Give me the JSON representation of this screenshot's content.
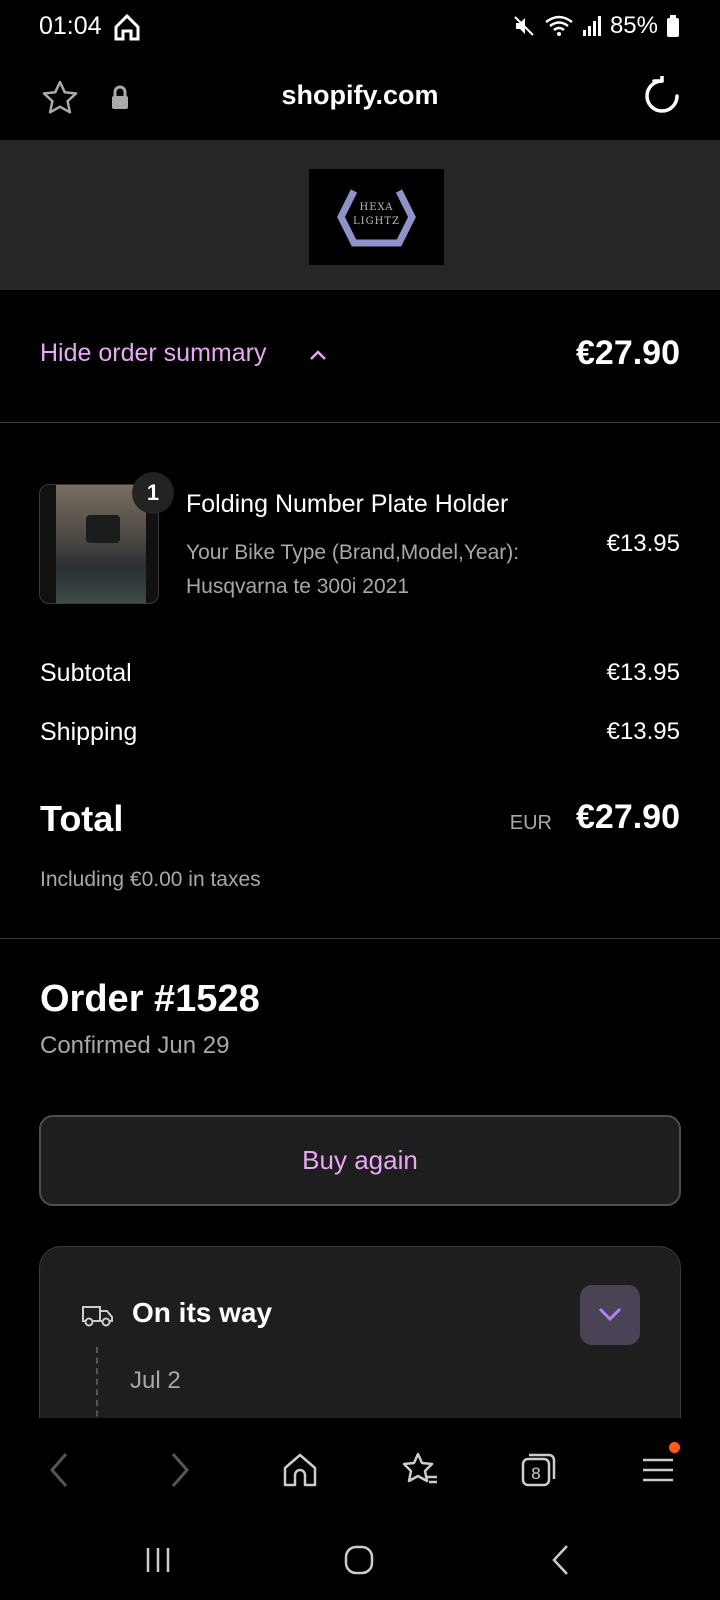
{
  "status_bar": {
    "time": "01:04",
    "battery": "85%",
    "icons": [
      "home-icon",
      "mute-icon",
      "wifi-icon",
      "signal-icon",
      "battery-icon"
    ]
  },
  "browser": {
    "url": "shopify.com",
    "tab_count": "8"
  },
  "logo": {
    "line1": "HEXA",
    "line2": "LIGHTZ"
  },
  "summary": {
    "toggle_label": "Hide order summary",
    "total": "€27.90"
  },
  "product": {
    "quantity": "1",
    "name": "Folding Number Plate Holder",
    "variant_label": "Your Bike Type (Brand,Model,Year):",
    "variant_value": "Husqvarna te 300i 2021",
    "price": "€13.95"
  },
  "totals": {
    "subtotal_label": "Subtotal",
    "subtotal_value": "€13.95",
    "shipping_label": "Shipping",
    "shipping_value": "€13.95",
    "total_label": "Total",
    "currency": "EUR",
    "total_value": "€27.90",
    "taxes_note": "Including €0.00 in taxes"
  },
  "order": {
    "title": "Order #1528",
    "confirmed": "Confirmed Jun 29",
    "buy_again_label": "Buy again"
  },
  "status_card": {
    "title": "On its way",
    "date": "Jul 2"
  },
  "colors": {
    "accent": "#e9a8f5",
    "background": "#000000",
    "surface": "#1e1e1e",
    "muted_text": "#a8a8a8"
  }
}
